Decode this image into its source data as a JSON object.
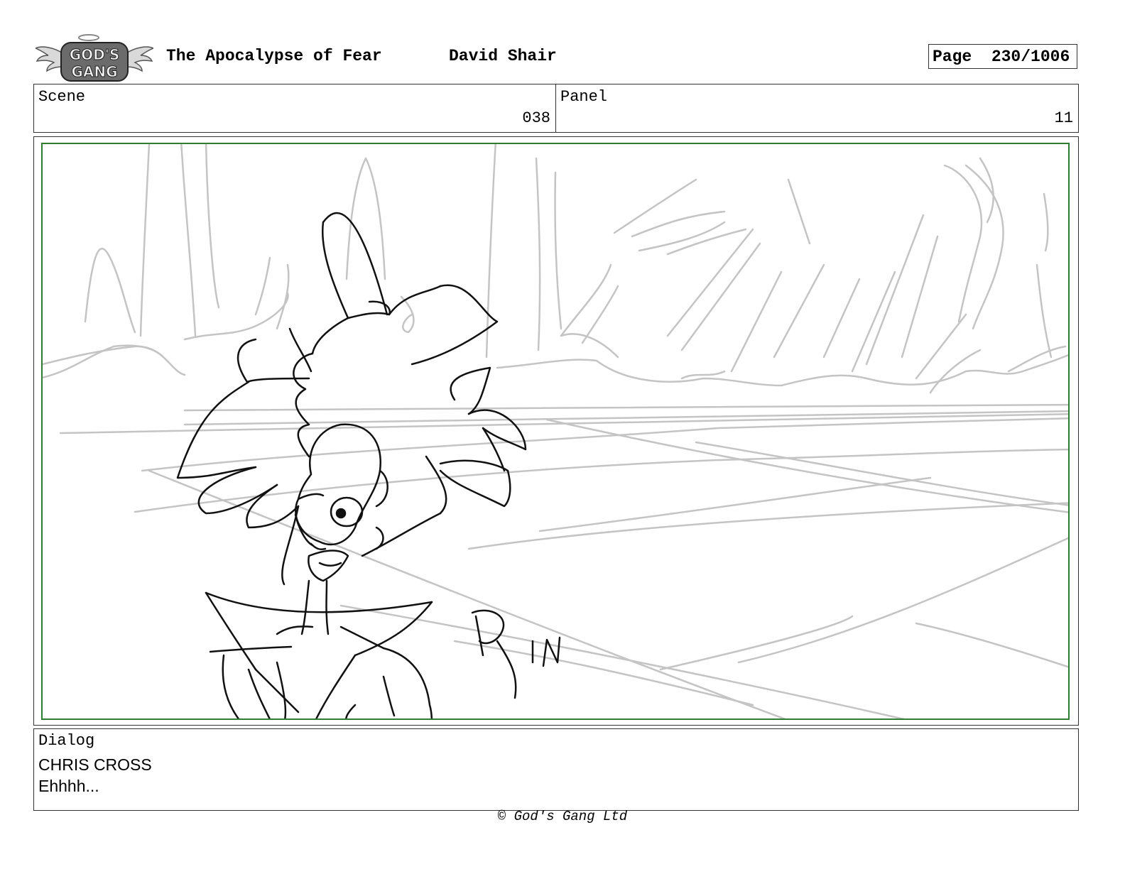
{
  "header": {
    "logo_text": "GOD'S GANG",
    "title": "The Apocalypse of Fear",
    "author": "David Shair",
    "page_label": "Page",
    "page_number": "230/1006"
  },
  "info": {
    "scene_label": "Scene",
    "scene_value": "038",
    "panel_label": "Panel",
    "panel_value": "11"
  },
  "panel": {
    "border_color": "#2e7d32",
    "sketch_text": "RIN"
  },
  "dialog": {
    "label": "Dialog",
    "speaker": "CHRIS CROSS",
    "line": "Ehhhh..."
  },
  "footer": {
    "copyright": "© God's Gang Ltd"
  }
}
